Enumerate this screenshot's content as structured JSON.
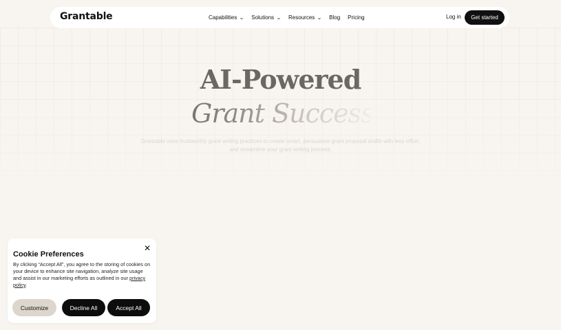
{
  "nav": {
    "logo": "Grantable",
    "links": [
      {
        "label": "Capabilities",
        "has_dropdown": true
      },
      {
        "label": "Solutions",
        "has_dropdown": true
      },
      {
        "label": "Resources",
        "has_dropdown": true
      },
      {
        "label": "Blog",
        "has_dropdown": false
      },
      {
        "label": "Pricing",
        "has_dropdown": false
      }
    ],
    "login": "Log in",
    "cta": "Get started"
  },
  "hero": {
    "line1": "AI-Powered",
    "line2": "Grant Success",
    "subtitle": "Grantable uses trustworthy grant writing practices to create smart, persuasive grant proposal drafts with less effort, and streamline your grant writing process."
  },
  "cookie": {
    "title": "Cookie Preferences",
    "body": "By clicking “Accept All”, you agree to the storing of cookies on your device to enhance site navigation, analyze site usage and assist in our marketing efforts as outlined in our ",
    "link": "privacy policy",
    "body_end": ".",
    "close_icon": "close-icon",
    "buttons": {
      "customize": "Customize",
      "decline": "Decline All",
      "accept": "Accept All"
    }
  },
  "colors": {
    "background": "#f8f5f0",
    "primary_button": "#0d0d0d",
    "secondary_button": "#dcd6cc",
    "hero_text": "#6b6862"
  }
}
